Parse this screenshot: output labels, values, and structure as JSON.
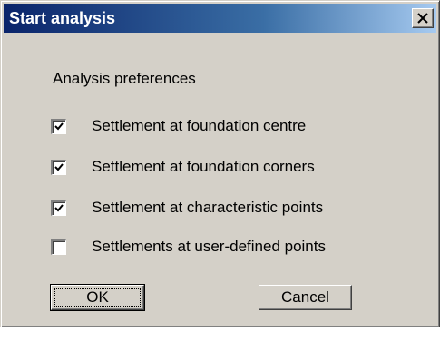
{
  "dialog": {
    "title": "Start analysis",
    "group_label": "Analysis preferences",
    "options": [
      {
        "label": "Settlement at foundation centre",
        "checked": true
      },
      {
        "label": "Settlement at foundation corners",
        "checked": true
      },
      {
        "label": "Settlement at characteristic points",
        "checked": true
      },
      {
        "label": "Settlements at user-defined points",
        "checked": false
      }
    ],
    "ok_label": "OK",
    "cancel_label": "Cancel"
  },
  "colors": {
    "face": "#d4d0c8",
    "title_start": "#0a246a",
    "title_end": "#a6caf0"
  },
  "icons": {
    "close": "close-icon",
    "check": "check-icon"
  }
}
